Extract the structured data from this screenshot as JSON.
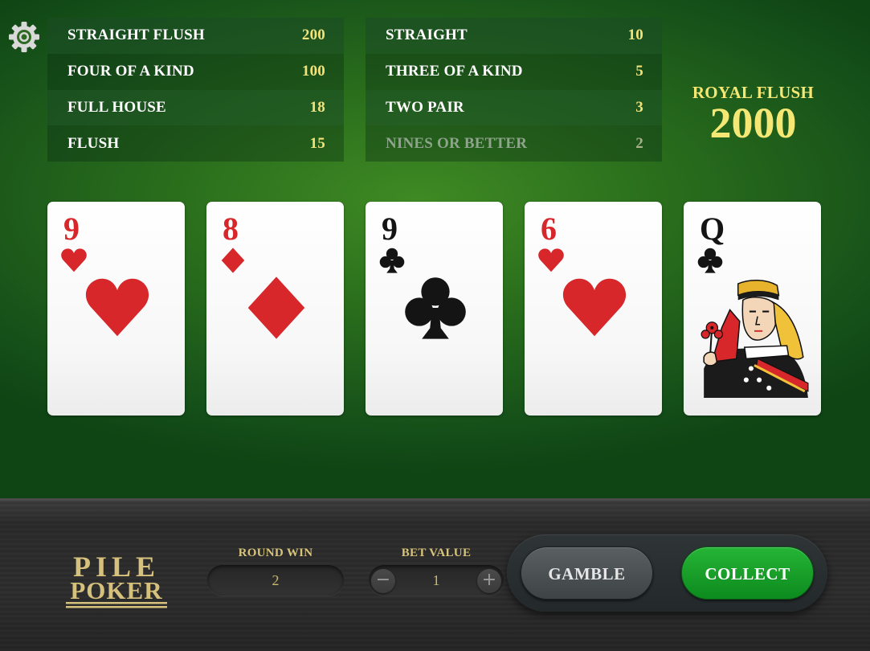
{
  "settings": {
    "icon": "gear-icon"
  },
  "paytable": {
    "left": [
      {
        "name": "STRAIGHT FLUSH",
        "value": "200"
      },
      {
        "name": "FOUR OF A KIND",
        "value": "100"
      },
      {
        "name": "FULL HOUSE",
        "value": "18"
      },
      {
        "name": "FLUSH",
        "value": "15"
      }
    ],
    "right": [
      {
        "name": "STRAIGHT",
        "value": "10"
      },
      {
        "name": "THREE OF A KIND",
        "value": "5"
      },
      {
        "name": "TWO PAIR",
        "value": "3"
      },
      {
        "name": "NINES OR BETTER",
        "value": "2"
      }
    ]
  },
  "royal_flush": {
    "label": "ROYAL FLUSH",
    "value": "2000"
  },
  "cards": [
    {
      "rank": "9",
      "suit": "hearts",
      "color": "#d7272b"
    },
    {
      "rank": "8",
      "suit": "diamonds",
      "color": "#d7272b"
    },
    {
      "rank": "9",
      "suit": "clubs",
      "color": "#141414"
    },
    {
      "rank": "6",
      "suit": "hearts",
      "color": "#d7272b"
    },
    {
      "rank": "Q",
      "suit": "clubs",
      "color": "#141414"
    }
  ],
  "logo": {
    "line1": "PILE",
    "line2": "POKER"
  },
  "round_win": {
    "label": "ROUND WIN",
    "value": "2"
  },
  "bet_value": {
    "label": "BET VALUE",
    "value": "1",
    "minus": "−",
    "plus": "+"
  },
  "buttons": {
    "gamble": "GAMBLE",
    "collect": "COLLECT"
  },
  "colors": {
    "table_green": "#2a6e1c",
    "gold": "#f4e774",
    "collect_green": "#1aa02b"
  }
}
